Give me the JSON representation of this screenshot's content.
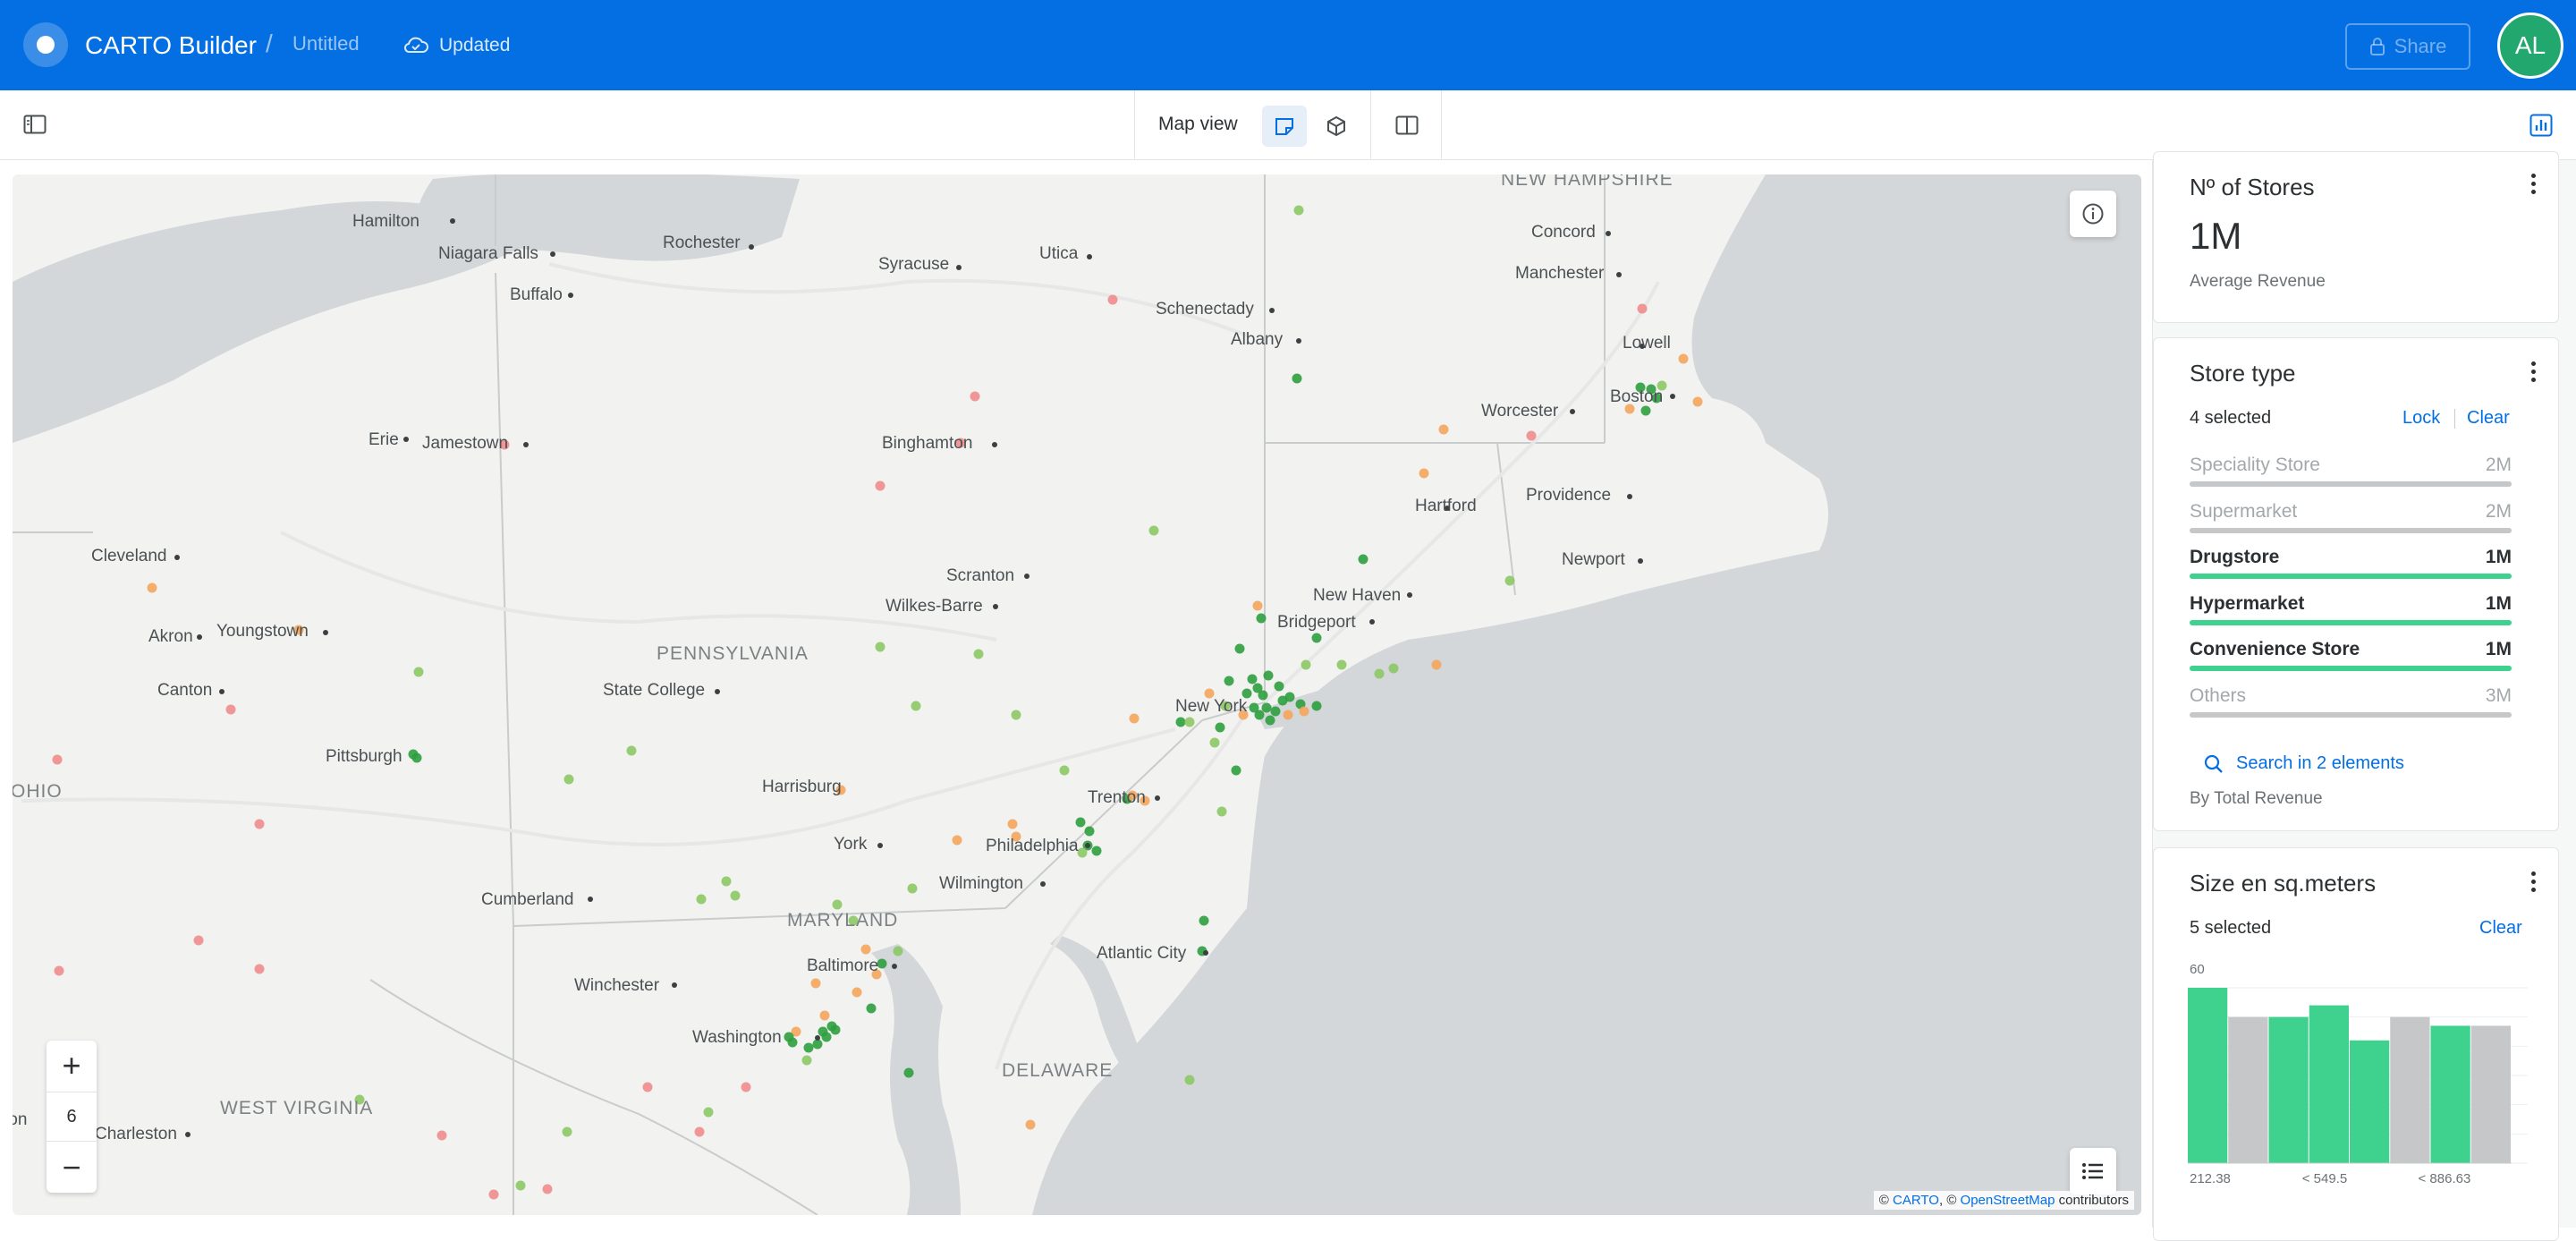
{
  "header": {
    "app_title": "CARTO Builder",
    "separator": "/",
    "map_name": "Untitled",
    "save_status": "Updated",
    "share_label": "Share",
    "avatar_initials": "AL",
    "brand_color": "#036fe2"
  },
  "toolbar": {
    "view_label": "Map view",
    "icons": [
      "panel-toggle-icon",
      "map-2d-icon",
      "map-3d-icon",
      "split-view-icon",
      "widgets-icon"
    ]
  },
  "map": {
    "zoom_level": "6",
    "zoom_in_label": "+",
    "zoom_out_label": "−",
    "attribution": {
      "prefix": "©",
      "carto": "CARTO",
      "sep": ", ©",
      "osm": "OpenStreetMap",
      "suffix": "contributors"
    },
    "places": [
      {
        "name": "NEW HAMPSHIRE",
        "kind": "region"
      },
      {
        "name": "Hamilton",
        "kind": "city"
      },
      {
        "name": "Niagara Falls",
        "kind": "city"
      },
      {
        "name": "Rochester",
        "kind": "city"
      },
      {
        "name": "Syracuse",
        "kind": "city"
      },
      {
        "name": "Utica",
        "kind": "city"
      },
      {
        "name": "Concord",
        "kind": "city"
      },
      {
        "name": "Buffalo",
        "kind": "city"
      },
      {
        "name": "Manchester",
        "kind": "city"
      },
      {
        "name": "Schenectady",
        "kind": "city"
      },
      {
        "name": "Albany",
        "kind": "city"
      },
      {
        "name": "Lowell",
        "kind": "city"
      },
      {
        "name": "Boston",
        "kind": "city"
      },
      {
        "name": "Worcester",
        "kind": "city"
      },
      {
        "name": "Erie",
        "kind": "city"
      },
      {
        "name": "Jamestown",
        "kind": "city"
      },
      {
        "name": "Binghamton",
        "kind": "city"
      },
      {
        "name": "Providence",
        "kind": "city"
      },
      {
        "name": "Hartford",
        "kind": "city"
      },
      {
        "name": "Cleveland",
        "kind": "city"
      },
      {
        "name": "Newport",
        "kind": "city"
      },
      {
        "name": "Scranton",
        "kind": "city"
      },
      {
        "name": "New Haven",
        "kind": "city"
      },
      {
        "name": "Akron",
        "kind": "city"
      },
      {
        "name": "Youngstown",
        "kind": "city"
      },
      {
        "name": "Wilkes-Barre",
        "kind": "city"
      },
      {
        "name": "Bridgeport",
        "kind": "city"
      },
      {
        "name": "PENNSYLVANIA",
        "kind": "region"
      },
      {
        "name": "Canton",
        "kind": "city"
      },
      {
        "name": "State College",
        "kind": "city"
      },
      {
        "name": "New York",
        "kind": "city"
      },
      {
        "name": "Pittsburgh",
        "kind": "city"
      },
      {
        "name": "OHIO",
        "kind": "region"
      },
      {
        "name": "Harrisburg",
        "kind": "city"
      },
      {
        "name": "Trenton",
        "kind": "city"
      },
      {
        "name": "York",
        "kind": "city"
      },
      {
        "name": "Philadelphia",
        "kind": "city"
      },
      {
        "name": "Wilmington",
        "kind": "city"
      },
      {
        "name": "Cumberland",
        "kind": "city"
      },
      {
        "name": "MARYLAND",
        "kind": "region"
      },
      {
        "name": "Baltimore",
        "kind": "city"
      },
      {
        "name": "Atlantic City",
        "kind": "city"
      },
      {
        "name": "Winchester",
        "kind": "city"
      },
      {
        "name": "Washington",
        "kind": "city"
      },
      {
        "name": "DELAWARE",
        "kind": "region"
      },
      {
        "name": "WEST VIRGINIA",
        "kind": "region"
      },
      {
        "name": "Charleston",
        "kind": "city"
      },
      {
        "name": "Lexington",
        "kind": "city"
      }
    ],
    "point_colors": [
      "#2e9e3e",
      "#8cc864",
      "#f5a55c",
      "#f08c8c"
    ]
  },
  "widgets": {
    "stores": {
      "title": "Nº of Stores",
      "value": "1M",
      "note": "Average Revenue"
    },
    "store_type": {
      "title": "Store type",
      "selected": "4 selected",
      "lock_label": "Lock",
      "clear_label": "Clear",
      "categories": [
        {
          "name": "Speciality Store",
          "value_label": "2M",
          "fraction": 1.0,
          "state": "dim"
        },
        {
          "name": "Supermarket",
          "value_label": "2M",
          "fraction": 1.0,
          "state": "dim"
        },
        {
          "name": "Drugstore",
          "value_label": "1M",
          "fraction": 1.0,
          "state": "on"
        },
        {
          "name": "Hypermarket",
          "value_label": "1M",
          "fraction": 1.0,
          "state": "on"
        },
        {
          "name": "Convenience Store",
          "value_label": "1M",
          "fraction": 1.0,
          "state": "on"
        },
        {
          "name": "Others",
          "value_label": "3M",
          "fraction": 1.0,
          "state": "dim"
        }
      ],
      "search_label": "Search in 2 elements",
      "note": "By Total Revenue",
      "active_color": "#3fd28f",
      "inactive_color": "#c5c7c9"
    },
    "size": {
      "title": "Size en sq.meters",
      "selected": "5 selected",
      "clear_label": "Clear",
      "chart_data": {
        "type": "bar",
        "y_tick_top": "60",
        "ylim": [
          0,
          60
        ],
        "x_tick_labels": [
          "212.38",
          "< 549.5",
          "< 886.63"
        ],
        "values": [
          60,
          50,
          50,
          54,
          42,
          50,
          47,
          47
        ],
        "selected": [
          true,
          false,
          true,
          true,
          true,
          false,
          true,
          false
        ]
      }
    }
  }
}
